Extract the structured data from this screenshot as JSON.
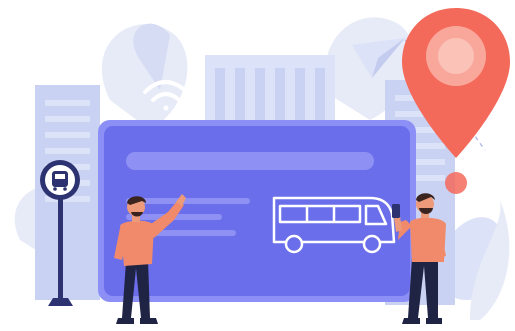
{
  "illustration": {
    "subject": "transit-card",
    "palette": {
      "background": "#ffffff",
      "card_fill": "#6B6EEA",
      "card_border": "#8C8FF5",
      "card_stripe": "#8E91F3",
      "building_light": "#DCE2F7",
      "building_mid": "#C9D2F3",
      "leaf": "#E7EBF7",
      "leaf_dark": "#C3CCEF",
      "accent_red": "#F46A5A",
      "accent_red_light": "#F9A79B",
      "skin": "#EC9A79",
      "shirt": "#F08A6A",
      "trousers": "#1F2344",
      "hair": "#3B2420",
      "stop_sign": "#2D3270"
    },
    "icons": [
      "wifi-icon",
      "bus-icon",
      "map-pin-icon",
      "paper-plane-icon",
      "bus-stop-sign-icon"
    ]
  }
}
